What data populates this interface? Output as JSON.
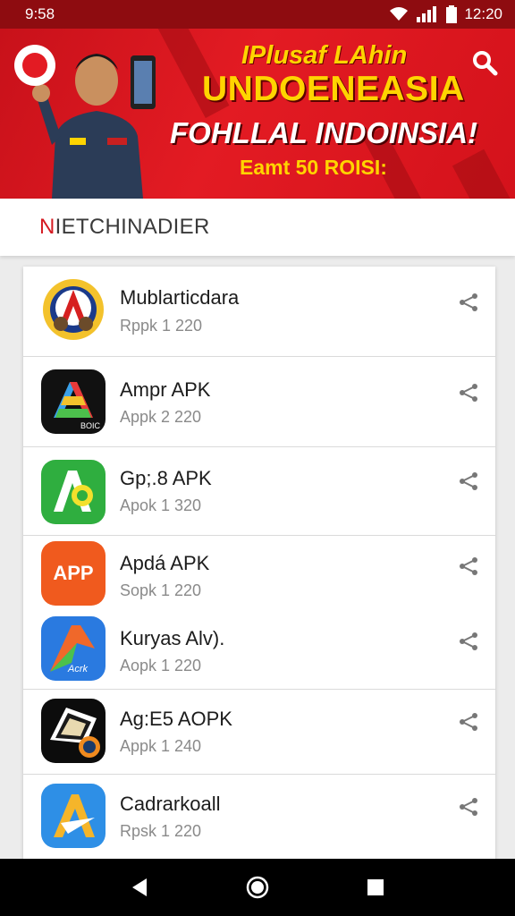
{
  "status_bar": {
    "time_left": "9:58",
    "time_right": "12:20"
  },
  "banner": {
    "line1": "IPlusaf LAhin",
    "line2": "UNDOENEASIA",
    "line3": "FOHLLAL INDOINSIA!",
    "line4": "Eamt 50 ROISI:",
    "colors": {
      "red": "#e31b23",
      "yellow": "#ffd400"
    }
  },
  "section": {
    "title_accent": "N",
    "title_rest": "IETCHINADIER"
  },
  "apps": [
    {
      "name": "Mublarticdara",
      "meta": "Rppk 1 220",
      "icon": "shield-a-icon"
    },
    {
      "name": "Ampr APK",
      "meta": "Appk 2 220",
      "icon": "colorful-a-icon"
    },
    {
      "name": "Gp;.8 APK",
      "meta": "Apok 1 320",
      "icon": "green-a-icon"
    },
    {
      "name": "Apdá APK",
      "meta": "Sopk 1 220",
      "icon": "orange-app-icon",
      "icon_text": "APP"
    },
    {
      "name": "Kuryas Alv).",
      "meta": "Aopk 1 220",
      "icon": "blue-arrow-icon",
      "icon_text": "Acrk"
    },
    {
      "name": "Ag:E5 AOPK",
      "meta": "Appk 1 240",
      "icon": "black-fan-icon"
    },
    {
      "name": "Cadrarkoall",
      "meta": "Rpsk 1 220",
      "icon": "blue-a-icon"
    }
  ],
  "icon_badge_text": "BOIC"
}
